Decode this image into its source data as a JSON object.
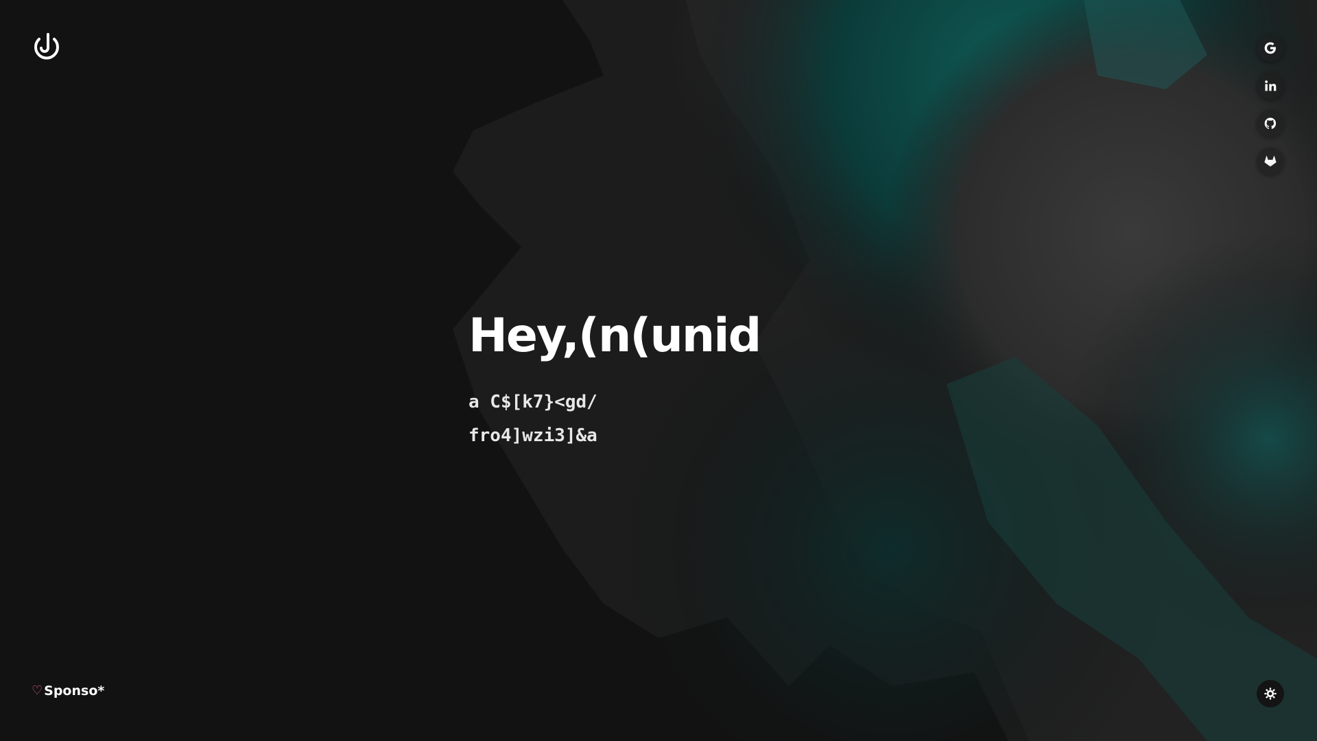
{
  "hero": {
    "title": "Hey,(n(unid",
    "subtitle_line_1": "a C$[k7}<gd/",
    "subtitle_line_2": "fro4]wzi3]&a"
  },
  "socials": [
    {
      "icon": "google-icon"
    },
    {
      "icon": "linkedin-icon"
    },
    {
      "icon": "github-icon"
    },
    {
      "icon": "gitlab-icon"
    }
  ],
  "footer": {
    "sponsor_label": "Sponso*",
    "sponsor_icon": "heart-icon",
    "theme_icon": "sun-icon"
  },
  "colors": {
    "background": "#121212",
    "accent_teal": "#0d4a47",
    "heart": "#e85a9a",
    "text": "#ffffff"
  }
}
